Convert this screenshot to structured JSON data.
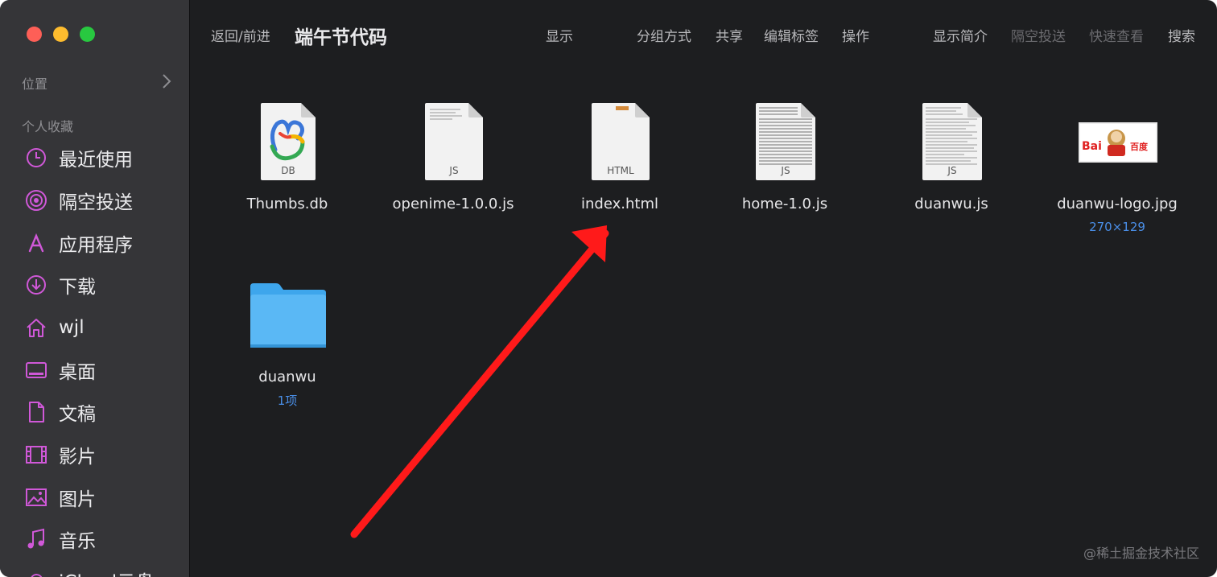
{
  "sidebar": {
    "location_label": "位置",
    "favorites_label": "个人收藏",
    "items": [
      {
        "label": "最近使用",
        "icon": "clock-icon"
      },
      {
        "label": "隔空投送",
        "icon": "airdrop-icon"
      },
      {
        "label": "应用程序",
        "icon": "applications-icon"
      },
      {
        "label": "下载",
        "icon": "download-icon"
      },
      {
        "label": "wjl",
        "icon": "home-icon"
      },
      {
        "label": "桌面",
        "icon": "desktop-icon"
      },
      {
        "label": "文稿",
        "icon": "document-icon"
      },
      {
        "label": "影片",
        "icon": "film-icon"
      },
      {
        "label": "图片",
        "icon": "photo-icon"
      },
      {
        "label": "音乐",
        "icon": "music-icon"
      },
      {
        "label": "iCloud云盘",
        "icon": "icloud-icon"
      }
    ]
  },
  "toolbar": {
    "back_forward": "返回/前进",
    "title": "端午节代码",
    "view": "显示",
    "group": "分组方式",
    "share": "共享",
    "tags": "编辑标签",
    "action": "操作",
    "info": "显示简介",
    "airdrop": "隔空投送",
    "quicklook": "快速查看",
    "search": "搜索"
  },
  "files": [
    {
      "name": "Thumbs.db",
      "type_label": "DB"
    },
    {
      "name": "openime-1.0.0.js",
      "type_label": "JS"
    },
    {
      "name": "index.html",
      "type_label": "HTML"
    },
    {
      "name": "home-1.0.js",
      "type_label": "JS"
    },
    {
      "name": "duanwu.js",
      "type_label": "JS"
    },
    {
      "name": "duanwu-logo.jpg",
      "meta": "270×129",
      "logo_text_left": "Bai",
      "logo_text_right": "百度"
    },
    {
      "name": "duanwu",
      "meta": "1项"
    }
  ],
  "watermark": "@稀土掘金技术社区",
  "colors": {
    "accent": "#d058d8",
    "folder": "#5ab8f5",
    "meta": "#4a8fe8",
    "arrow": "#ff1a1a"
  }
}
